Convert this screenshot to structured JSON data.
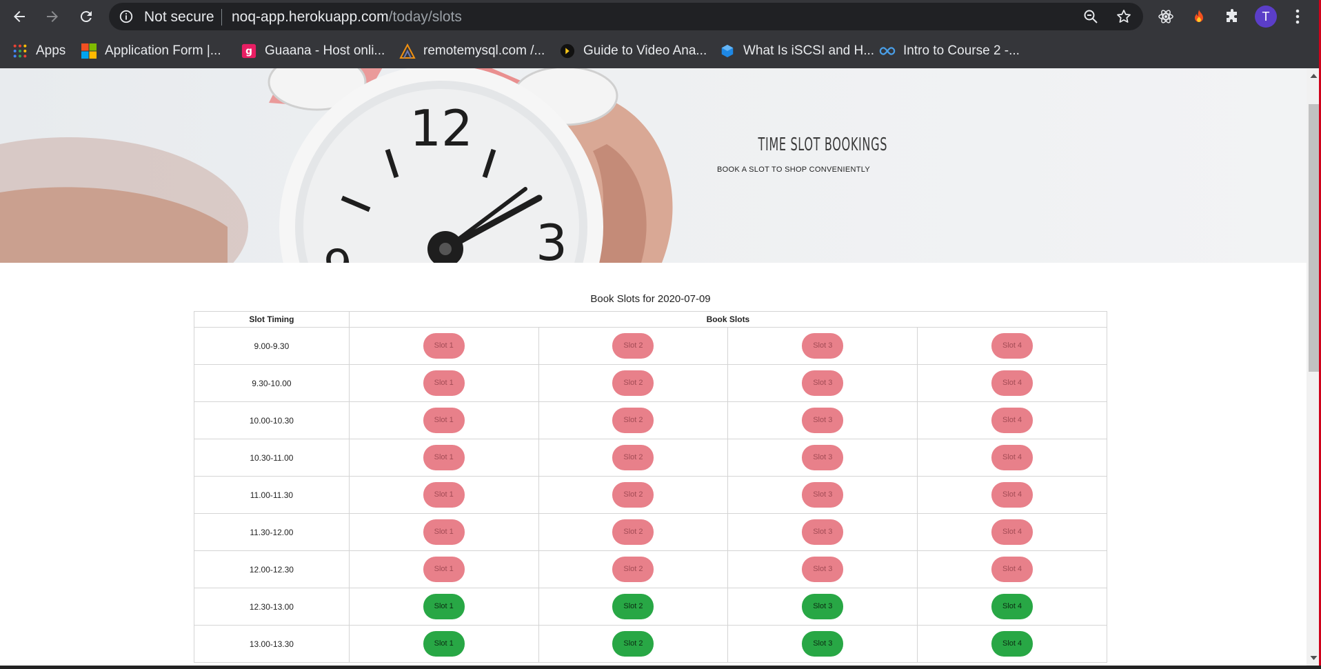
{
  "browser": {
    "security_label": "Not secure",
    "url_host": "noq-app.herokuapp.com",
    "url_path": "/today/slots",
    "profile_initial": "T",
    "bookmarks": [
      {
        "label": "Apps",
        "icon": "apps-grid-icon"
      },
      {
        "label": "Application Form |...",
        "icon": "microsoft-logo-icon"
      },
      {
        "label": "Guaana - Host onli...",
        "icon": "guaana-icon"
      },
      {
        "label": "remotemysql.com /...",
        "icon": "phpmyadmin-icon"
      },
      {
        "label": "Guide to Video Ana...",
        "icon": "video-guide-icon"
      },
      {
        "label": "What Is iSCSI and H...",
        "icon": "cube-icon"
      },
      {
        "label": "Intro to Course 2 -...",
        "icon": "infinity-icon"
      }
    ]
  },
  "hero": {
    "title": "TIME SLOT BOOKINGS",
    "subtitle": "BOOK A SLOT TO SHOP CONVENIENTLY"
  },
  "table": {
    "caption": "Book Slots for 2020-07-09",
    "headers": {
      "timing": "Slot Timing",
      "slots": "Book Slots"
    },
    "slot_labels": [
      "Slot 1",
      "Slot 2",
      "Slot 3",
      "Slot 4"
    ],
    "rows": [
      {
        "time": "9.00-9.30",
        "status": "booked"
      },
      {
        "time": "9.30-10.00",
        "status": "booked"
      },
      {
        "time": "10.00-10.30",
        "status": "booked"
      },
      {
        "time": "10.30-11.00",
        "status": "booked"
      },
      {
        "time": "11.00-11.30",
        "status": "booked"
      },
      {
        "time": "11.30-12.00",
        "status": "booked"
      },
      {
        "time": "12.00-12.30",
        "status": "booked"
      },
      {
        "time": "12.30-13.00",
        "status": "open"
      },
      {
        "time": "13.00-13.30",
        "status": "open"
      }
    ]
  },
  "colors": {
    "booked": "#e8808a",
    "open": "#28a745",
    "chrome": "#35363a",
    "omnibox": "#202124"
  }
}
